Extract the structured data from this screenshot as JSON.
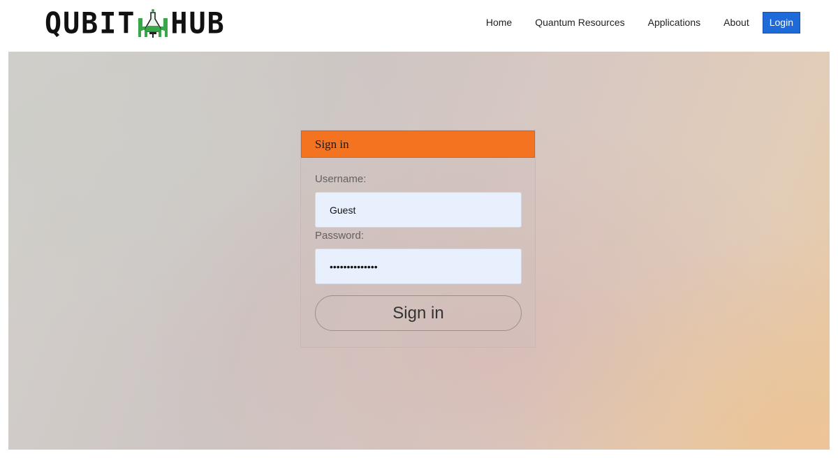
{
  "brand": {
    "name_left": "QUBIT",
    "name_right": "HUB",
    "mark_icon": "flask-and-chairs-icon",
    "colors": {
      "mark_green": "#3aa64a",
      "text": "#111111"
    }
  },
  "nav": {
    "items": [
      {
        "label": "Home"
      },
      {
        "label": "Quantum Resources"
      },
      {
        "label": "Applications"
      },
      {
        "label": "About"
      }
    ],
    "login_label": "Login",
    "login_color": "#1e6ad8"
  },
  "signin": {
    "header": "Sign in",
    "header_color": "#f37321",
    "username_label": "Username:",
    "username_value": "Guest",
    "password_label": "Password:",
    "password_value": "••••••••••••••",
    "submit_label": "Sign in"
  }
}
